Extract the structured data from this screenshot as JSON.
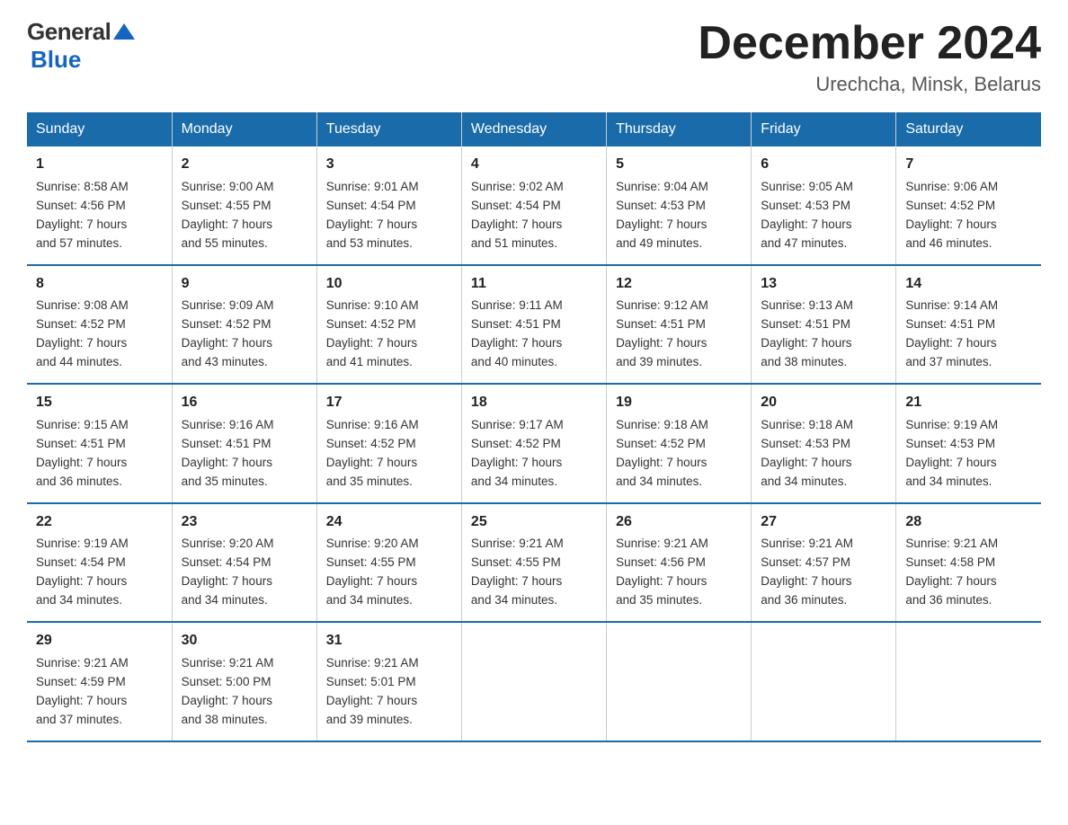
{
  "header": {
    "logo_general": "General",
    "logo_blue": "Blue",
    "month_title": "December 2024",
    "location": "Urechcha, Minsk, Belarus"
  },
  "weekdays": [
    "Sunday",
    "Monday",
    "Tuesday",
    "Wednesday",
    "Thursday",
    "Friday",
    "Saturday"
  ],
  "weeks": [
    [
      {
        "day": "1",
        "sunrise": "8:58 AM",
        "sunset": "4:56 PM",
        "daylight": "7 hours and 57 minutes."
      },
      {
        "day": "2",
        "sunrise": "9:00 AM",
        "sunset": "4:55 PM",
        "daylight": "7 hours and 55 minutes."
      },
      {
        "day": "3",
        "sunrise": "9:01 AM",
        "sunset": "4:54 PM",
        "daylight": "7 hours and 53 minutes."
      },
      {
        "day": "4",
        "sunrise": "9:02 AM",
        "sunset": "4:54 PM",
        "daylight": "7 hours and 51 minutes."
      },
      {
        "day": "5",
        "sunrise": "9:04 AM",
        "sunset": "4:53 PM",
        "daylight": "7 hours and 49 minutes."
      },
      {
        "day": "6",
        "sunrise": "9:05 AM",
        "sunset": "4:53 PM",
        "daylight": "7 hours and 47 minutes."
      },
      {
        "day": "7",
        "sunrise": "9:06 AM",
        "sunset": "4:52 PM",
        "daylight": "7 hours and 46 minutes."
      }
    ],
    [
      {
        "day": "8",
        "sunrise": "9:08 AM",
        "sunset": "4:52 PM",
        "daylight": "7 hours and 44 minutes."
      },
      {
        "day": "9",
        "sunrise": "9:09 AM",
        "sunset": "4:52 PM",
        "daylight": "7 hours and 43 minutes."
      },
      {
        "day": "10",
        "sunrise": "9:10 AM",
        "sunset": "4:52 PM",
        "daylight": "7 hours and 41 minutes."
      },
      {
        "day": "11",
        "sunrise": "9:11 AM",
        "sunset": "4:51 PM",
        "daylight": "7 hours and 40 minutes."
      },
      {
        "day": "12",
        "sunrise": "9:12 AM",
        "sunset": "4:51 PM",
        "daylight": "7 hours and 39 minutes."
      },
      {
        "day": "13",
        "sunrise": "9:13 AM",
        "sunset": "4:51 PM",
        "daylight": "7 hours and 38 minutes."
      },
      {
        "day": "14",
        "sunrise": "9:14 AM",
        "sunset": "4:51 PM",
        "daylight": "7 hours and 37 minutes."
      }
    ],
    [
      {
        "day": "15",
        "sunrise": "9:15 AM",
        "sunset": "4:51 PM",
        "daylight": "7 hours and 36 minutes."
      },
      {
        "day": "16",
        "sunrise": "9:16 AM",
        "sunset": "4:51 PM",
        "daylight": "7 hours and 35 minutes."
      },
      {
        "day": "17",
        "sunrise": "9:16 AM",
        "sunset": "4:52 PM",
        "daylight": "7 hours and 35 minutes."
      },
      {
        "day": "18",
        "sunrise": "9:17 AM",
        "sunset": "4:52 PM",
        "daylight": "7 hours and 34 minutes."
      },
      {
        "day": "19",
        "sunrise": "9:18 AM",
        "sunset": "4:52 PM",
        "daylight": "7 hours and 34 minutes."
      },
      {
        "day": "20",
        "sunrise": "9:18 AM",
        "sunset": "4:53 PM",
        "daylight": "7 hours and 34 minutes."
      },
      {
        "day": "21",
        "sunrise": "9:19 AM",
        "sunset": "4:53 PM",
        "daylight": "7 hours and 34 minutes."
      }
    ],
    [
      {
        "day": "22",
        "sunrise": "9:19 AM",
        "sunset": "4:54 PM",
        "daylight": "7 hours and 34 minutes."
      },
      {
        "day": "23",
        "sunrise": "9:20 AM",
        "sunset": "4:54 PM",
        "daylight": "7 hours and 34 minutes."
      },
      {
        "day": "24",
        "sunrise": "9:20 AM",
        "sunset": "4:55 PM",
        "daylight": "7 hours and 34 minutes."
      },
      {
        "day": "25",
        "sunrise": "9:21 AM",
        "sunset": "4:55 PM",
        "daylight": "7 hours and 34 minutes."
      },
      {
        "day": "26",
        "sunrise": "9:21 AM",
        "sunset": "4:56 PM",
        "daylight": "7 hours and 35 minutes."
      },
      {
        "day": "27",
        "sunrise": "9:21 AM",
        "sunset": "4:57 PM",
        "daylight": "7 hours and 36 minutes."
      },
      {
        "day": "28",
        "sunrise": "9:21 AM",
        "sunset": "4:58 PM",
        "daylight": "7 hours and 36 minutes."
      }
    ],
    [
      {
        "day": "29",
        "sunrise": "9:21 AM",
        "sunset": "4:59 PM",
        "daylight": "7 hours and 37 minutes."
      },
      {
        "day": "30",
        "sunrise": "9:21 AM",
        "sunset": "5:00 PM",
        "daylight": "7 hours and 38 minutes."
      },
      {
        "day": "31",
        "sunrise": "9:21 AM",
        "sunset": "5:01 PM",
        "daylight": "7 hours and 39 minutes."
      },
      null,
      null,
      null,
      null
    ]
  ],
  "labels": {
    "sunrise": "Sunrise:",
    "sunset": "Sunset:",
    "daylight": "Daylight:"
  }
}
